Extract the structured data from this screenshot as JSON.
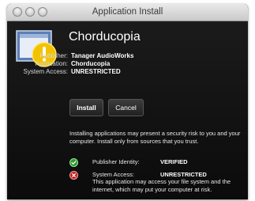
{
  "window": {
    "title": "Application Install"
  },
  "app": {
    "name": "Chorducopia",
    "publisher_label": "Publisher:",
    "publisher": "Tanager AudioWorks",
    "application_label": "Application:",
    "application": "Chorducopia",
    "system_access_label": "System Access:",
    "system_access": "UNRESTRICTED"
  },
  "buttons": {
    "install": "Install",
    "cancel": "Cancel"
  },
  "warning": "Installing applications may present a security risk to you and your computer. Install only from sources that you trust.",
  "checks": [
    {
      "label": "Publisher Identity:",
      "value": "VERIFIED",
      "status": "ok"
    },
    {
      "label": "System Access:",
      "value": "UNRESTRICTED",
      "status": "bad",
      "description": "This application may access your file system and the internet, which may put your computer at risk."
    }
  ],
  "colors": {
    "background": "#111111",
    "ok": "#2e9a2e",
    "bad": "#c22121",
    "warning_icon": "#f2c200"
  }
}
